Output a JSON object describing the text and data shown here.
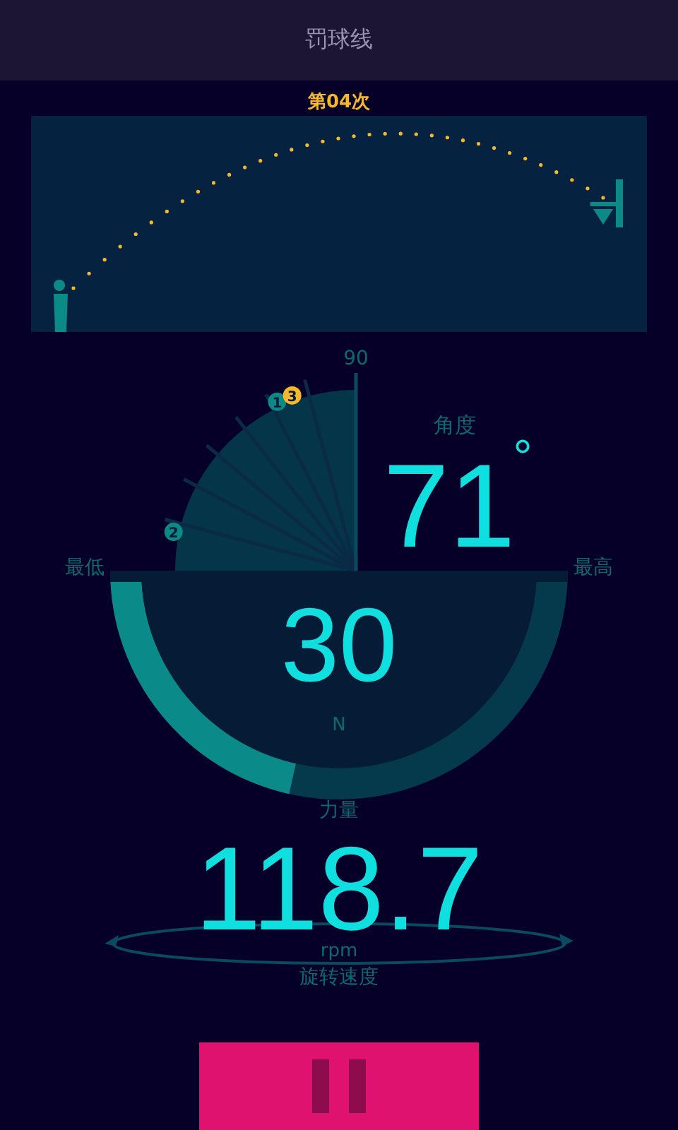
{
  "window": {
    "title": "罚球线"
  },
  "attempt": "第04次",
  "angle": {
    "label": "角度",
    "value": "71",
    "unit": "°",
    "max_label": "90",
    "low_label": "最低",
    "high_label": "最高",
    "shots": [
      {
        "label": "1",
        "color": "#0b8a86"
      },
      {
        "label": "2",
        "color": "#0b8a86"
      },
      {
        "label": "3",
        "color": "#f5b82a"
      }
    ]
  },
  "force": {
    "value": "30",
    "unit": "N",
    "label": "力量"
  },
  "spin": {
    "value": "118.7",
    "unit": "rpm",
    "label": "旋转速度"
  },
  "controls": {
    "kind": "pause"
  }
}
